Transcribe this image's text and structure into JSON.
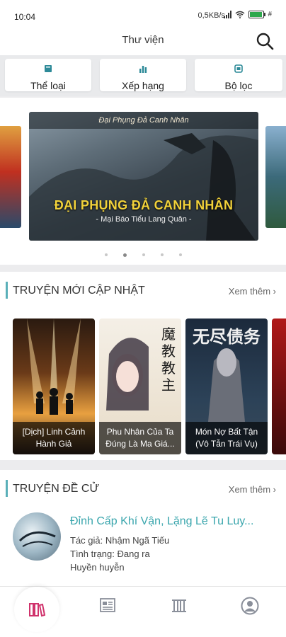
{
  "status_bar": {
    "time": "10:04",
    "speed": "0,5KB/s",
    "battery_level": 0.9
  },
  "header": {
    "title": "Thư viện"
  },
  "tiles": [
    {
      "label": "Thể loại",
      "icon": "book-icon"
    },
    {
      "label": "Xếp hạng",
      "icon": "bar-chart-icon"
    },
    {
      "label": "Bộ lọc",
      "icon": "filter-icon"
    }
  ],
  "banner": {
    "subtitle": "Đại Phụng Đả Canh Nhân",
    "title": "ĐẠI PHỤNG ĐẢ CANH NHÂN",
    "author": "- Mại Báo Tiểu Lang Quân -",
    "active_dot": 1,
    "dot_count": 5
  },
  "new_updates": {
    "title": "TRUYỆN MỚI CẬP NHẬT",
    "more": "Xem thêm",
    "books": [
      {
        "line1": "[Dịch] Linh Cảnh",
        "line2": "Hành Giả"
      },
      {
        "line1": "Phu Nhân Của Ta",
        "line2": "Đúng Là Ma Giá..."
      },
      {
        "line1": "Món Nợ Bất Tận",
        "line2": "(Vô Tẫn Trái Vụ)"
      }
    ],
    "cover_texts": {
      "book2": "魔教教主",
      "book3": "无尽债务"
    }
  },
  "recommended": {
    "title": "TRUYỆN ĐỀ CỬ",
    "more": "Xem thêm",
    "item": {
      "title": "Đỉnh Cấp Khí Vận, Lặng Lẽ Tu Luy...",
      "author": "Tác giả: Nhậm Ngã Tiếu",
      "status": "Tình trạng: Đang ra",
      "genre": "Huyền huyễn"
    }
  },
  "colors": {
    "accent": "#5ab0b9",
    "banner_title": "#f2d23a",
    "active_nav": "#d0336c"
  },
  "nav": [
    "library-icon",
    "news-icon",
    "ranking-icon",
    "account-icon"
  ]
}
